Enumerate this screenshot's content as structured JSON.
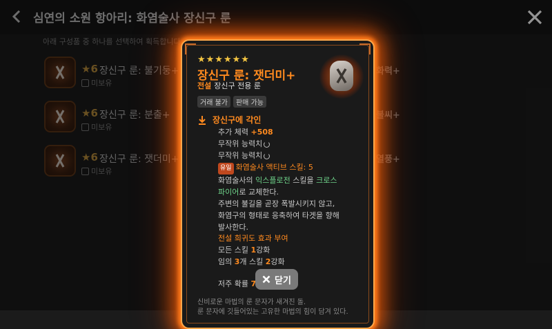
{
  "header": {
    "title": "심연의 소원 항아리: 화염술사 장신구 룬",
    "instruction": "아래 구성품 중 하나를 선택하여 획득합니다."
  },
  "list": {
    "items": [
      {
        "grade": "★6",
        "name": "장신구 룬: 불기둥+",
        "status": "미보유"
      },
      {
        "grade": "★6",
        "name": "장신구 룬: 분출+",
        "status": "미보유"
      },
      {
        "grade": "★6",
        "name": "장신구 룬: 잿더미+",
        "status": "미보유"
      }
    ],
    "right_labels": [
      "화력+",
      "불씨+",
      "열풍+"
    ]
  },
  "card": {
    "stars": "★★★★★★",
    "title": "장신구 룬: 잿더미+",
    "grade": "전설",
    "subtitle": "장신구 전용 룬",
    "tags": [
      "거래 불가",
      "판매 가능"
    ],
    "engrave_title": "장신구에 각인",
    "stat_label": "추가 체력",
    "stat_value": "+508",
    "random1": "무작위 능력치",
    "random2": "무작위 능력치",
    "unique_badge": "유일",
    "skill_line": "화염술사 액티브 스킬: 5",
    "desc_a": "화염술사의 ",
    "desc_skill1": "익스플로전",
    "desc_b": " 스킬을 ",
    "desc_skill2a": "크로스",
    "desc_skill2b": "파이어",
    "desc_c": "로 교체한다.",
    "desc_d": "주변의 불길을 곧장 폭발시키지 않고,",
    "desc_e": "화염구의 형태로 응축하여 타겟을 향해",
    "desc_f": "발사한다.",
    "effect_title": "전설 희귀도 효과 부여",
    "effect1_a": "모든 스킬 ",
    "effect1_n": "1",
    "effect1_b": "강화",
    "effect2_a": "임의 ",
    "effect2_n1": "3",
    "effect2_b": "개 스킬 ",
    "effect2_n2": "2",
    "effect2_c": "강화",
    "drop_label": "저주 확률 ",
    "drop_value": "7",
    "flavor1": "신비로운 마법의 룬 문자가 새겨진 돌.",
    "flavor2": "룬 문자에 깃들어있는 고유한 마법의 힘이 담겨 있다."
  },
  "close_button": {
    "label": "닫기"
  },
  "colors": {
    "accent": "#ff8a1f",
    "glow": "#ff7a1a",
    "skill_green": "#6fd38a"
  }
}
